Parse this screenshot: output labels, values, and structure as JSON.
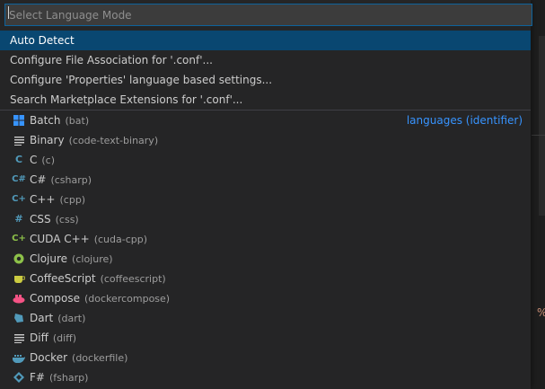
{
  "input": {
    "placeholder": "Select Language Mode",
    "value": ""
  },
  "actions": [
    {
      "label": "Auto Detect",
      "selected": true
    },
    {
      "label": "Configure File Association for '.conf'..."
    },
    {
      "label": "Configure 'Properties' language based settings..."
    },
    {
      "label": "Search Marketplace Extensions for '.conf'..."
    }
  ],
  "group_label": "languages (identifier)",
  "languages": [
    {
      "name": "Batch",
      "id": "(bat)",
      "icon": "windows-icon",
      "color": "#3794ff"
    },
    {
      "name": "Binary",
      "id": "(code-text-binary)",
      "icon": "lines-icon",
      "color": "#cccccc"
    },
    {
      "name": "C",
      "id": "(c)",
      "icon": "c-icon",
      "color": "#519aba"
    },
    {
      "name": "C#",
      "id": "(csharp)",
      "icon": "csharp-icon",
      "color": "#519aba"
    },
    {
      "name": "C++",
      "id": "(cpp)",
      "icon": "cpp-icon",
      "color": "#519aba"
    },
    {
      "name": "CSS",
      "id": "(css)",
      "icon": "hash-icon",
      "color": "#519aba"
    },
    {
      "name": "CUDA C++",
      "id": "(cuda-cpp)",
      "icon": "cuda-icon",
      "color": "#8dc149"
    },
    {
      "name": "Clojure",
      "id": "(clojure)",
      "icon": "clojure-icon",
      "color": "#8dc149"
    },
    {
      "name": "CoffeeScript",
      "id": "(coffeescript)",
      "icon": "coffee-icon",
      "color": "#cbcb41"
    },
    {
      "name": "Compose",
      "id": "(dockercompose)",
      "icon": "compose-icon",
      "color": "#f55385"
    },
    {
      "name": "Dart",
      "id": "(dart)",
      "icon": "dart-icon",
      "color": "#519aba"
    },
    {
      "name": "Diff",
      "id": "(diff)",
      "icon": "lines-icon",
      "color": "#cccccc"
    },
    {
      "name": "Docker",
      "id": "(dockerfile)",
      "icon": "docker-icon",
      "color": "#519aba"
    },
    {
      "name": "F#",
      "id": "(fsharp)",
      "icon": "fsharp-icon",
      "color": "#519aba"
    }
  ]
}
